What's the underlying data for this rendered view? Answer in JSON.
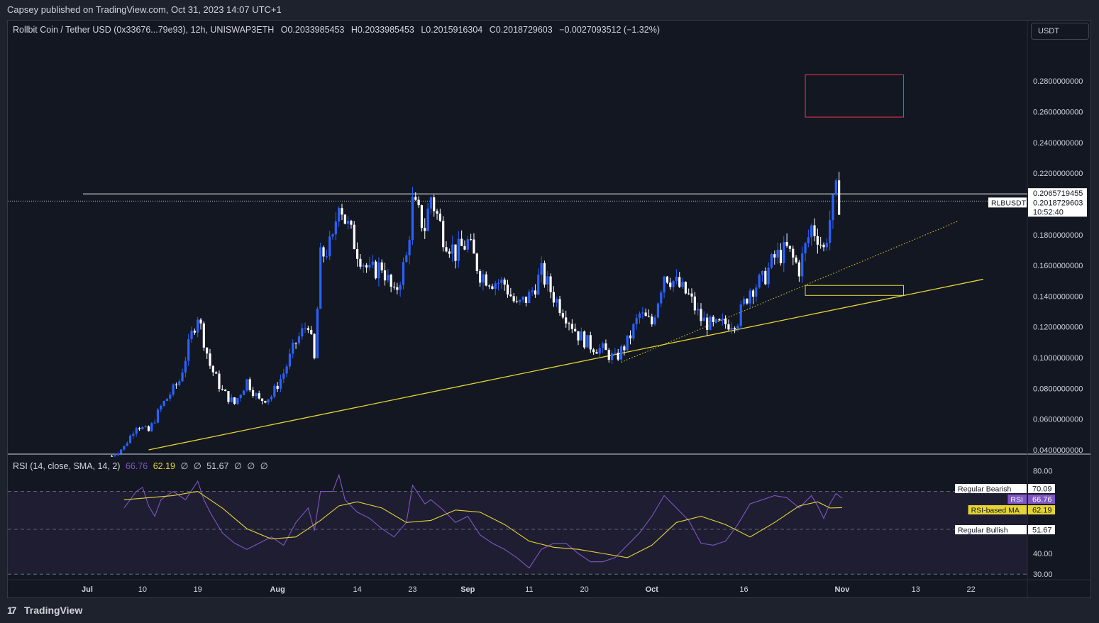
{
  "header": {
    "published": "Capsey published on TradingView.com, Oct 31, 2023 14:07 UTC+1"
  },
  "legend": {
    "symbol": "Rollbit Coin / Tether USD (0x33676...79e93), 12h, UNISWAP3ETH",
    "open": "O0.2033985453",
    "high": "H0.2033985453",
    "low": "L0.2015916304",
    "close": "C0.2018729603",
    "change": "−0.0027093512 (−1.32%)"
  },
  "currency_button": "USDT",
  "rsi_legend": {
    "title": "RSI (14, close, SMA, 14, 2)",
    "rsi": "66.76",
    "ma": "62.19",
    "na1": "∅",
    "na2": "∅",
    "v51": "51.67",
    "na3": "∅",
    "na4": "∅",
    "na5": "∅"
  },
  "footer": {
    "brand": "TradingView",
    "logo_mark": "17"
  },
  "colors": {
    "background": "#131722",
    "up": "#2962ff",
    "down": "#ffffff",
    "trendline": "#e5d434",
    "rsi": "#7e57c2",
    "rsi_ma": "#e5d434",
    "target_box": "#f23645",
    "support_box": "#e5d434"
  },
  "chart_data": [
    {
      "type": "candlestick",
      "price_axis": {
        "ticks": [
          "0.2800000000",
          "0.2600000000",
          "0.2400000000",
          "0.2200000000",
          "0.1800000000",
          "0.1600000000",
          "0.1400000000",
          "0.1200000000",
          "0.1000000000",
          "0.0800000000",
          "0.0600000000",
          "0.0400000000"
        ],
        "ylim": [
          0.04,
          0.305
        ]
      },
      "price_labels": [
        {
          "name": "resistance",
          "value": "0.2065719455"
        },
        {
          "name": "last",
          "value": "0.2018729603",
          "symbol": "RLBUSDT",
          "countdown": "10:52:40"
        }
      ],
      "time_axis": [
        {
          "label": "Jul",
          "day": 0,
          "bold": true
        },
        {
          "label": "10",
          "day": 9
        },
        {
          "label": "19",
          "day": 18
        },
        {
          "label": "Aug",
          "day": 31,
          "bold": true
        },
        {
          "label": "14",
          "day": 44
        },
        {
          "label": "23",
          "day": 53
        },
        {
          "label": "Sep",
          "day": 62,
          "bold": true
        },
        {
          "label": "11",
          "day": 72
        },
        {
          "label": "20",
          "day": 81
        },
        {
          "label": "Oct",
          "day": 92,
          "bold": true
        },
        {
          "label": "16",
          "day": 107
        },
        {
          "label": "Nov",
          "day": 123,
          "bold": true
        },
        {
          "label": "13",
          "day": 135
        },
        {
          "label": "22",
          "day": 144
        }
      ],
      "close_path": [
        [
          4,
          0.036
        ],
        [
          6,
          0.042
        ],
        [
          8,
          0.056
        ],
        [
          10,
          0.052
        ],
        [
          12,
          0.068
        ],
        [
          15,
          0.085
        ],
        [
          17,
          0.115
        ],
        [
          18,
          0.128
        ],
        [
          20,
          0.095
        ],
        [
          22,
          0.078
        ],
        [
          24,
          0.07
        ],
        [
          26,
          0.085
        ],
        [
          28,
          0.072
        ],
        [
          30,
          0.075
        ],
        [
          32,
          0.09
        ],
        [
          34,
          0.11
        ],
        [
          36,
          0.123
        ],
        [
          37,
          0.098
        ],
        [
          38,
          0.165
        ],
        [
          40,
          0.175
        ],
        [
          41,
          0.205
        ],
        [
          42,
          0.19
        ],
        [
          44,
          0.17
        ],
        [
          46,
          0.155
        ],
        [
          48,
          0.16
        ],
        [
          50,
          0.14
        ],
        [
          52,
          0.165
        ],
        [
          53,
          0.2
        ],
        [
          55,
          0.185
        ],
        [
          56,
          0.205
        ],
        [
          58,
          0.18
        ],
        [
          60,
          0.168
        ],
        [
          62,
          0.175
        ],
        [
          64,
          0.155
        ],
        [
          66,
          0.15
        ],
        [
          68,
          0.148
        ],
        [
          70,
          0.133
        ],
        [
          72,
          0.14
        ],
        [
          74,
          0.155
        ],
        [
          76,
          0.14
        ],
        [
          78,
          0.128
        ],
        [
          80,
          0.115
        ],
        [
          82,
          0.108
        ],
        [
          84,
          0.105
        ],
        [
          86,
          0.099
        ],
        [
          88,
          0.11
        ],
        [
          90,
          0.128
        ],
        [
          92,
          0.122
        ],
        [
          94,
          0.155
        ],
        [
          96,
          0.148
        ],
        [
          98,
          0.14
        ],
        [
          100,
          0.125
        ],
        [
          102,
          0.12
        ],
        [
          104,
          0.122
        ],
        [
          106,
          0.125
        ],
        [
          108,
          0.145
        ],
        [
          110,
          0.15
        ],
        [
          112,
          0.165
        ],
        [
          114,
          0.17
        ],
        [
          116,
          0.158
        ],
        [
          118,
          0.185
        ],
        [
          119,
          0.18
        ],
        [
          120,
          0.17
        ],
        [
          121,
          0.19
        ],
        [
          122,
          0.2065
        ],
        [
          122.5,
          0.2018
        ]
      ],
      "resistance_level": 0.2065719455,
      "last_price": 0.2018729603,
      "trendlines": [
        {
          "name": "rising-support",
          "style": "solid",
          "from": [
            10,
            0.04
          ],
          "to": [
            146,
            0.151
          ]
        },
        {
          "name": "inner-support",
          "style": "dotted",
          "from": [
            87,
            0.097
          ],
          "to": [
            142,
            0.189
          ]
        }
      ],
      "zones": [
        {
          "name": "target-zone",
          "x": [
            117,
            133
          ],
          "y": [
            0.2565,
            0.284
          ]
        },
        {
          "name": "support-zone",
          "x": [
            117,
            133
          ],
          "y": [
            0.1405,
            0.147
          ]
        }
      ]
    },
    {
      "type": "line",
      "title": "RSI (14, close, SMA, 14, 2)",
      "y_axis": {
        "ticks": [
          "80.00",
          "40.00",
          "30.00"
        ],
        "ylim": [
          28,
          86
        ]
      },
      "bands": {
        "upper": 70,
        "lower": 30,
        "middle": 51.67
      },
      "rsi": [
        [
          6,
          62
        ],
        [
          8,
          70
        ],
        [
          9,
          72
        ],
        [
          10,
          63
        ],
        [
          11,
          58
        ],
        [
          12,
          66
        ],
        [
          14,
          70
        ],
        [
          16,
          66
        ],
        [
          18,
          75
        ],
        [
          19,
          66
        ],
        [
          20,
          60
        ],
        [
          22,
          50
        ],
        [
          24,
          45
        ],
        [
          26,
          42
        ],
        [
          28,
          45
        ],
        [
          30,
          48
        ],
        [
          32,
          44
        ],
        [
          34,
          55
        ],
        [
          36,
          62
        ],
        [
          37,
          51
        ],
        [
          38,
          70
        ],
        [
          40,
          70
        ],
        [
          41,
          78
        ],
        [
          42,
          66
        ],
        [
          44,
          60
        ],
        [
          46,
          57
        ],
        [
          48,
          52
        ],
        [
          50,
          48
        ],
        [
          52,
          55
        ],
        [
          53,
          73
        ],
        [
          55,
          64
        ],
        [
          56,
          66
        ],
        [
          58,
          61
        ],
        [
          60,
          55
        ],
        [
          62,
          58
        ],
        [
          64,
          49
        ],
        [
          66,
          45
        ],
        [
          68,
          42
        ],
        [
          70,
          38
        ],
        [
          72,
          33
        ],
        [
          74,
          42
        ],
        [
          76,
          45
        ],
        [
          78,
          45
        ],
        [
          80,
          40
        ],
        [
          82,
          36
        ],
        [
          84,
          36
        ],
        [
          86,
          38
        ],
        [
          88,
          44
        ],
        [
          90,
          50
        ],
        [
          92,
          58
        ],
        [
          94,
          68
        ],
        [
          96,
          62
        ],
        [
          98,
          56
        ],
        [
          100,
          45
        ],
        [
          102,
          44
        ],
        [
          104,
          46
        ],
        [
          106,
          54
        ],
        [
          108,
          64
        ],
        [
          110,
          66
        ],
        [
          112,
          68
        ],
        [
          114,
          67
        ],
        [
          116,
          62
        ],
        [
          118,
          68
        ],
        [
          119,
          63
        ],
        [
          120,
          57
        ],
        [
          121,
          64
        ],
        [
          122,
          69
        ],
        [
          123,
          66.76
        ]
      ],
      "rsi_ma": [
        [
          6,
          66
        ],
        [
          10,
          67
        ],
        [
          14,
          68
        ],
        [
          18,
          70
        ],
        [
          22,
          62
        ],
        [
          26,
          52
        ],
        [
          30,
          47
        ],
        [
          34,
          48
        ],
        [
          38,
          56
        ],
        [
          41,
          63
        ],
        [
          44,
          65
        ],
        [
          48,
          62
        ],
        [
          52,
          55
        ],
        [
          56,
          56
        ],
        [
          60,
          61
        ],
        [
          64,
          60
        ],
        [
          68,
          54
        ],
        [
          72,
          46
        ],
        [
          76,
          43
        ],
        [
          80,
          42
        ],
        [
          84,
          40
        ],
        [
          88,
          38
        ],
        [
          92,
          44
        ],
        [
          96,
          55
        ],
        [
          100,
          58
        ],
        [
          104,
          54
        ],
        [
          108,
          48
        ],
        [
          112,
          55
        ],
        [
          116,
          63
        ],
        [
          119,
          65
        ],
        [
          121,
          62
        ],
        [
          123,
          62.19
        ]
      ],
      "labels": [
        {
          "name": "regular-bearish",
          "text": "Regular Bearish",
          "value": "70.09"
        },
        {
          "name": "rsi",
          "text": "RSI",
          "value": "66.76"
        },
        {
          "name": "rsi-ma",
          "text": "RSI-based MA",
          "value": "62.19"
        },
        {
          "name": "regular-bullish",
          "text": "Regular Bullish",
          "value": "51.67"
        }
      ]
    }
  ]
}
